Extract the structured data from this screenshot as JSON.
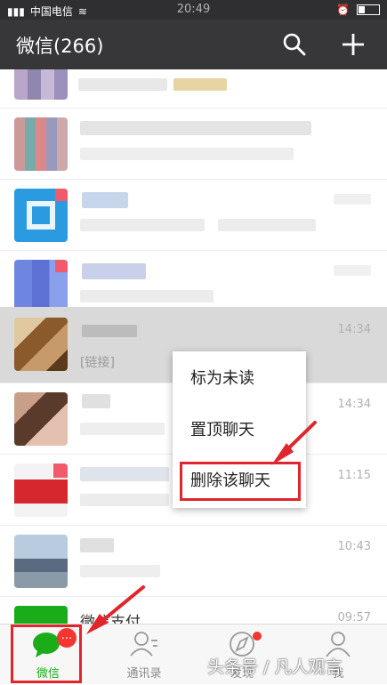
{
  "status_bar": {
    "carrier": "中国电信",
    "time": "20:49"
  },
  "header": {
    "title": "微信(266)"
  },
  "chats": [
    {
      "name": "",
      "preview": "",
      "time": ""
    },
    {
      "name": "",
      "preview": "",
      "time": ""
    },
    {
      "name": "",
      "preview": "",
      "time": ""
    },
    {
      "name": "",
      "preview": "",
      "time": ""
    },
    {
      "name": "",
      "preview": "[链接]",
      "time": "14:34"
    },
    {
      "name": "",
      "preview": "",
      "time": "14:34"
    },
    {
      "name": "",
      "preview": "",
      "time": "11:15"
    },
    {
      "name": "",
      "preview": "",
      "time": "10:43"
    },
    {
      "name": "微信支付",
      "preview": "",
      "time": "09:57"
    }
  ],
  "context_menu": {
    "items": [
      "标为未读",
      "置顶聊天",
      "删除该聊天"
    ]
  },
  "tabbar": {
    "tabs": [
      "微信",
      "通讯录",
      "发现",
      "我"
    ],
    "badge": "..."
  },
  "watermark": "头条号 / 凡人观言",
  "colors": {
    "header_bg": "#37373a",
    "accent_green": "#1aad19",
    "badge_red": "#f43530",
    "annotation_red": "#e0262c"
  }
}
